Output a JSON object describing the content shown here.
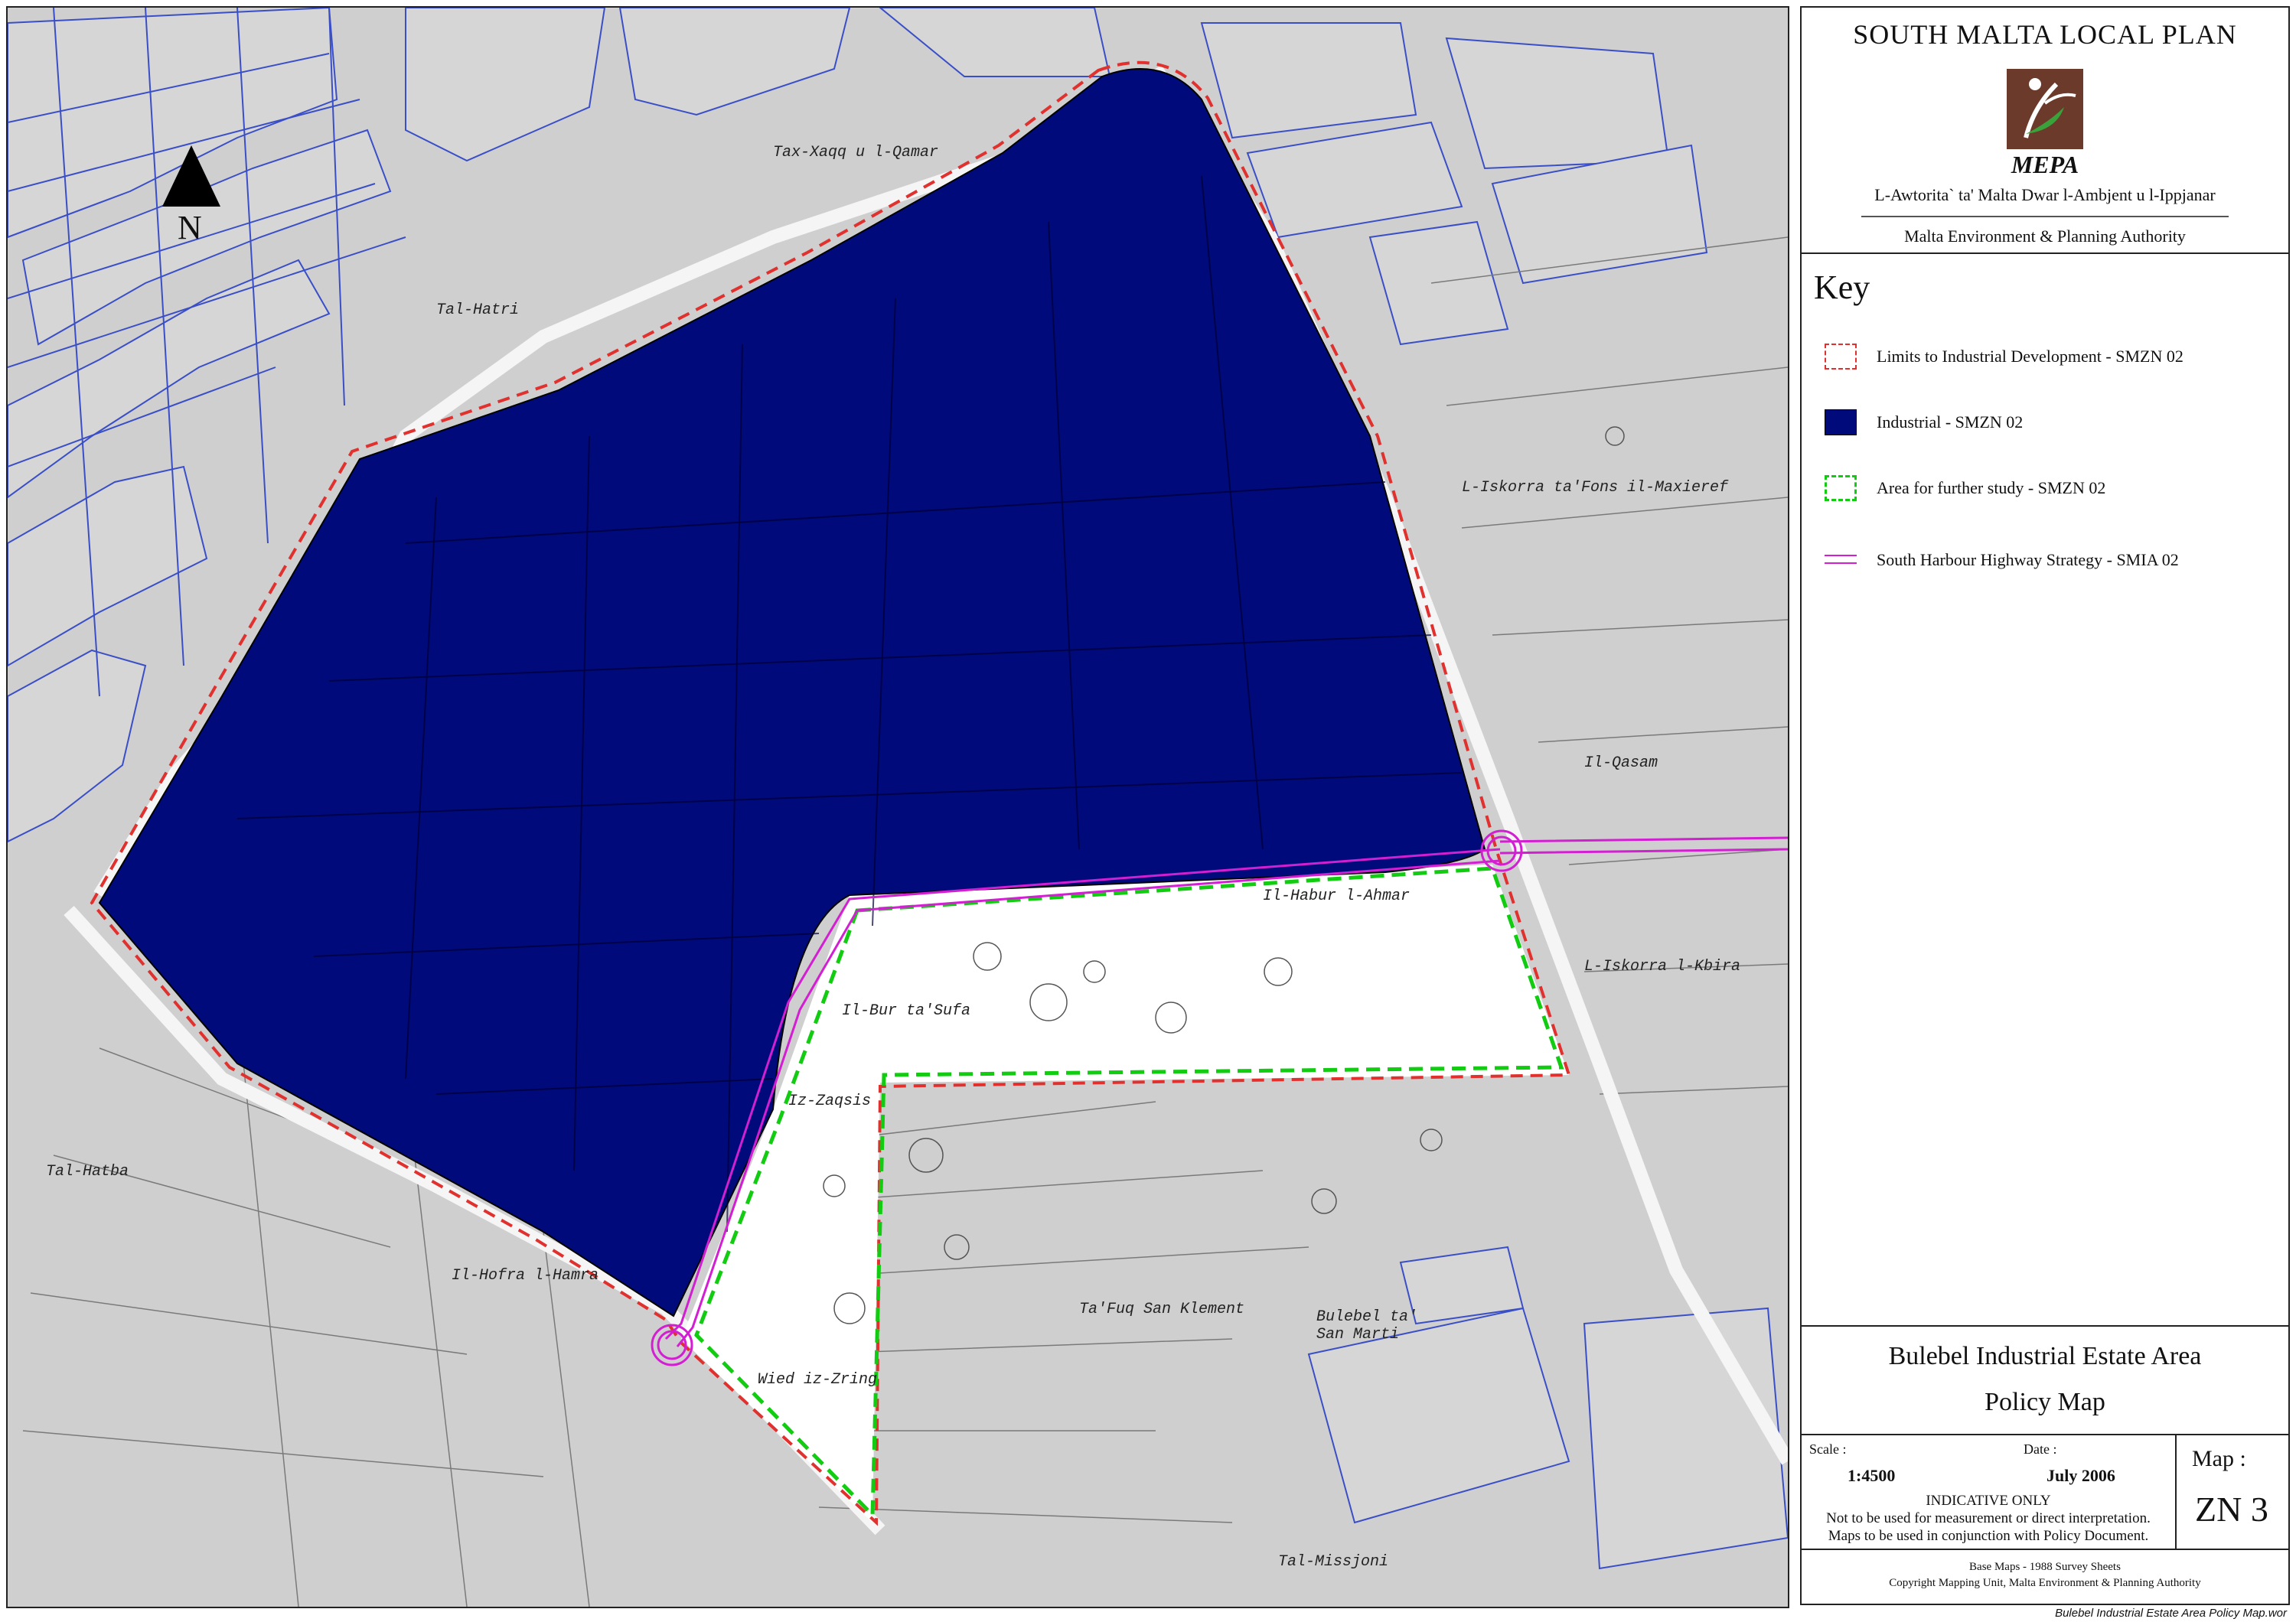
{
  "map": {
    "place_labels": [
      {
        "id": "tax-xaqq",
        "text": "Tax-Xaqq u l-Qamar"
      },
      {
        "id": "tal-hatri",
        "text": "Tal-Hatri"
      },
      {
        "id": "iskorra-fons",
        "text": "L-Iskorra ta'Fons il-Maxieref"
      },
      {
        "id": "il-qasam",
        "text": "Il-Qasam"
      },
      {
        "id": "iskorra-kbira",
        "text": "L-Iskorra l-Kbira"
      },
      {
        "id": "il-bur",
        "text": "Il-Bur ta'Sufa"
      },
      {
        "id": "iz-zaqsis",
        "text": "Iz-Zaqsis"
      },
      {
        "id": "tal-hatba",
        "text": "Tal-Hatba"
      },
      {
        "id": "il-hofra",
        "text": "Il-Hofra l-Hamra"
      },
      {
        "id": "ta-fuq",
        "text": "Ta'Fuq San Klement"
      },
      {
        "id": "bulebel",
        "text": "Bulebel ta' San Marti"
      },
      {
        "id": "wied",
        "text": "Wied iz-Zring"
      },
      {
        "id": "tal-missjoni",
        "text": "Tal-Missjoni"
      },
      {
        "id": "il-habur",
        "text": "Il-Habur l-Ahmar"
      }
    ],
    "north_label": "N",
    "colors": {
      "base": "#cfcfcf",
      "industrial": "#000a7a",
      "limits": "#e0312f",
      "study": "#11cc11",
      "highway": "#d21fd2",
      "streets": "#3a4fc7"
    }
  },
  "header": {
    "plan_title": "SOUTH MALTA LOCAL PLAN",
    "logo_text": "MEPA",
    "authority_mt": "L-Awtorita` ta' Malta Dwar l-Ambjent u l-Ippjanar",
    "authority_en": "Malta Environment & Planning Authority"
  },
  "key": {
    "title": "Key",
    "items": [
      {
        "label": "Limits to Industrial Development - SMZN 02"
      },
      {
        "label": "Industrial - SMZN 02"
      },
      {
        "label": "Area for further study - SMZN 02"
      },
      {
        "label": "South Harbour Highway Strategy - SMIA 02"
      }
    ]
  },
  "title_block": {
    "area_title": "Bulebel Industrial Estate Area",
    "map_type": "Policy Map"
  },
  "meta": {
    "scale_label": "Scale :",
    "scale_value": "1:4500",
    "date_label": "Date :",
    "date_value": "July 2006",
    "indicative_1": "INDICATIVE ONLY",
    "indicative_2": "Not to be used for measurement or direct interpretation.",
    "indicative_3": "Maps to be used in conjunction with Policy Document.",
    "map_label": "Map :",
    "map_code": "ZN 3"
  },
  "footer": {
    "base_maps": "Base Maps - 1988 Survey Sheets",
    "copyright": "Copyright Mapping Unit, Malta Environment & Planning Authority"
  },
  "file_caption": "Bulebel Industrial Estate Area Policy Map.wor"
}
